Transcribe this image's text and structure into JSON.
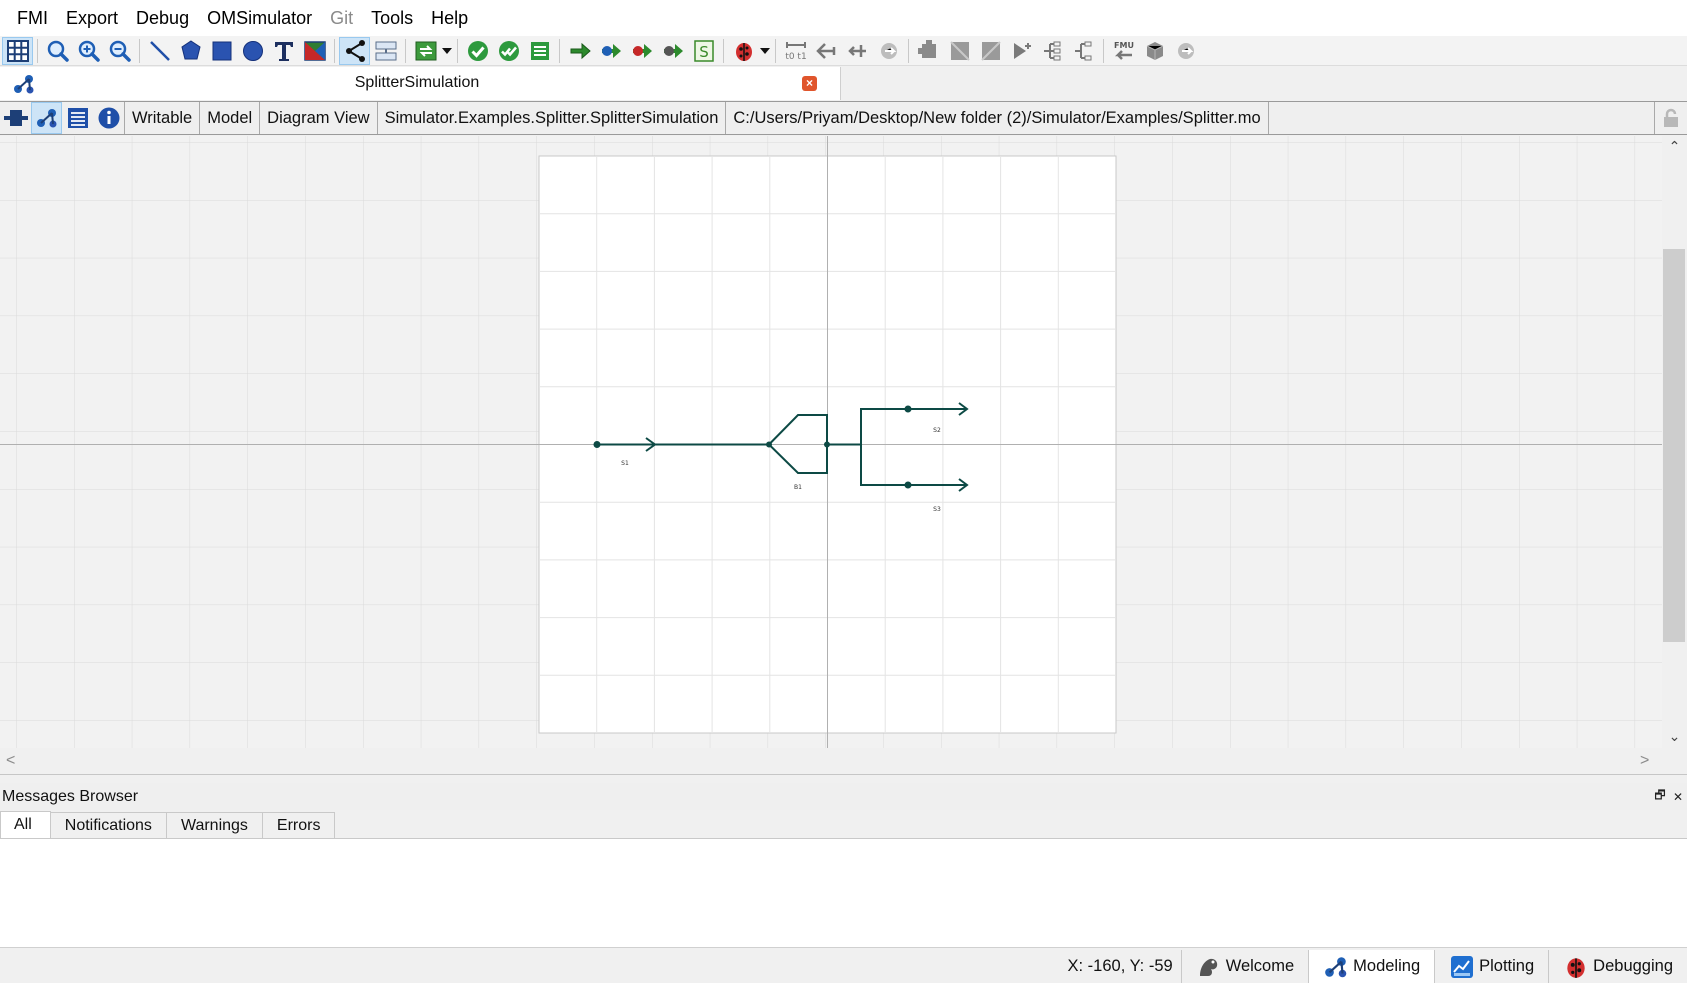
{
  "menubar": {
    "items": [
      {
        "label": "FMI",
        "disabled": false
      },
      {
        "label": "Export",
        "disabled": false
      },
      {
        "label": "Debug",
        "disabled": false
      },
      {
        "label": "OMSimulator",
        "disabled": false
      },
      {
        "label": "Git",
        "disabled": true
      },
      {
        "label": "Tools",
        "disabled": false
      },
      {
        "label": "Help",
        "disabled": false
      }
    ]
  },
  "toolbar": {
    "icons": [
      "grid-icon",
      "zoom-fit-icon",
      "zoom-in-icon",
      "zoom-out-icon",
      "line-icon",
      "polygon-icon",
      "rectangle-icon",
      "ellipse-icon",
      "text-icon",
      "bitmap-icon",
      "connect-mode-icon",
      "transition-mode-icon",
      "simulation-params-icon",
      "check-model-icon",
      "check-all-models-icon",
      "instantiate-model-icon",
      "simulate-icon",
      "simulate-with-transformational-debugger-icon",
      "simulate-with-algorithmic-debugger-icon",
      "simulate-with-animation-icon",
      "simulation-setup-icon",
      "debug-configurations-icon",
      "fmu-export-icon"
    ]
  },
  "document_tab": {
    "title": "SplitterSimulation",
    "close_glyph": "×"
  },
  "infobar": {
    "access": "Writable",
    "restriction": "Model",
    "view": "Diagram View",
    "class_name": "Simulator.Examples.Splitter.SplitterSimulation",
    "file_path": "C:/Users/Priyam/Desktop/New folder (2)/Simulator/Examples/Splitter.mo"
  },
  "diagram": {
    "components": [
      {
        "name": "S1"
      },
      {
        "name": "B1"
      },
      {
        "name": "S2"
      },
      {
        "name": "S3"
      }
    ],
    "line_color": "#0d4a45"
  },
  "scroll": {
    "up": "⌃",
    "down": "⌄",
    "left": "<",
    "right": ">"
  },
  "messages": {
    "title": "Messages Browser",
    "float_glyph": "🗗",
    "close_glyph": "✕",
    "tabs": [
      "All",
      "Notifications",
      "Warnings",
      "Errors"
    ]
  },
  "statusbar": {
    "coords": "X: -160, Y: -59",
    "perspectives": [
      {
        "label": "Welcome",
        "active": false
      },
      {
        "label": "Modeling",
        "active": true
      },
      {
        "label": "Plotting",
        "active": false
      },
      {
        "label": "Debugging",
        "active": false
      }
    ]
  }
}
